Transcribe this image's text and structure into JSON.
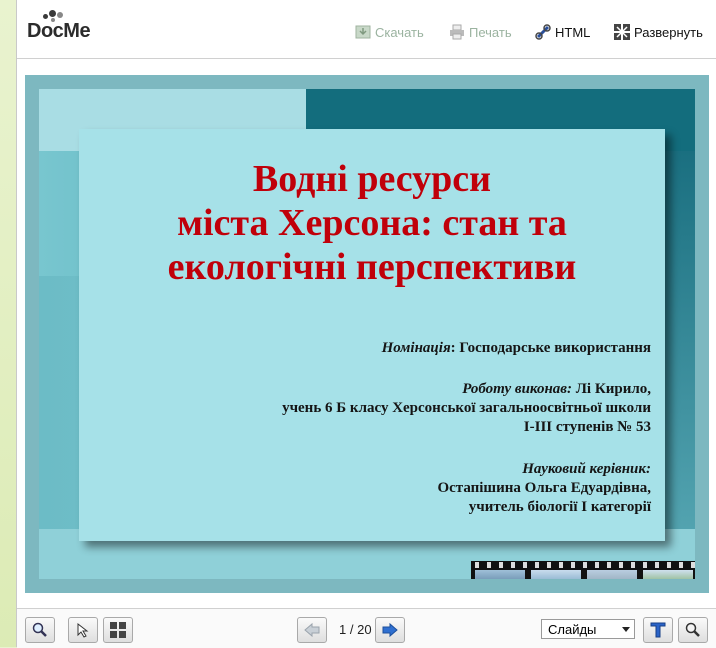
{
  "app": {
    "logo_text": "DocMe"
  },
  "toolbar": {
    "download_label": "Скачать",
    "print_label": "Печать",
    "html_label": "HTML",
    "expand_label": "Развернуть"
  },
  "slide": {
    "title_line1": "Водні ресурси",
    "title_line2": "міста Херсона: стан та",
    "title_line3": "екологічні перспективи",
    "nomination_label": "Номінація",
    "nomination_value": ": Господарське використання",
    "author_label": "Роботу виконав:",
    "author_name": " Лі Кирило,",
    "author_line2": "учень 6 Б класу Херсонської загальноосвітньої школи",
    "author_line3": "I-III ступенів № 53",
    "advisor_label": "Науковий керівник:",
    "advisor_name": "Остапішина Ольга Едуардівна,",
    "advisor_role": "учитель біології І категорії"
  },
  "bottom": {
    "current_page": "1",
    "total_pages": "/ 20",
    "view_mode": "Слайды"
  },
  "icons": [
    "zoom-in-icon",
    "pointer-icon",
    "fit-icon",
    "prev-icon",
    "next-icon",
    "text-icon",
    "search-icon",
    "download-icon",
    "print-icon",
    "html-link-icon",
    "expand-icon"
  ],
  "colors": {
    "title_red": "#c0000a",
    "accent_teal": "#136d7d"
  }
}
